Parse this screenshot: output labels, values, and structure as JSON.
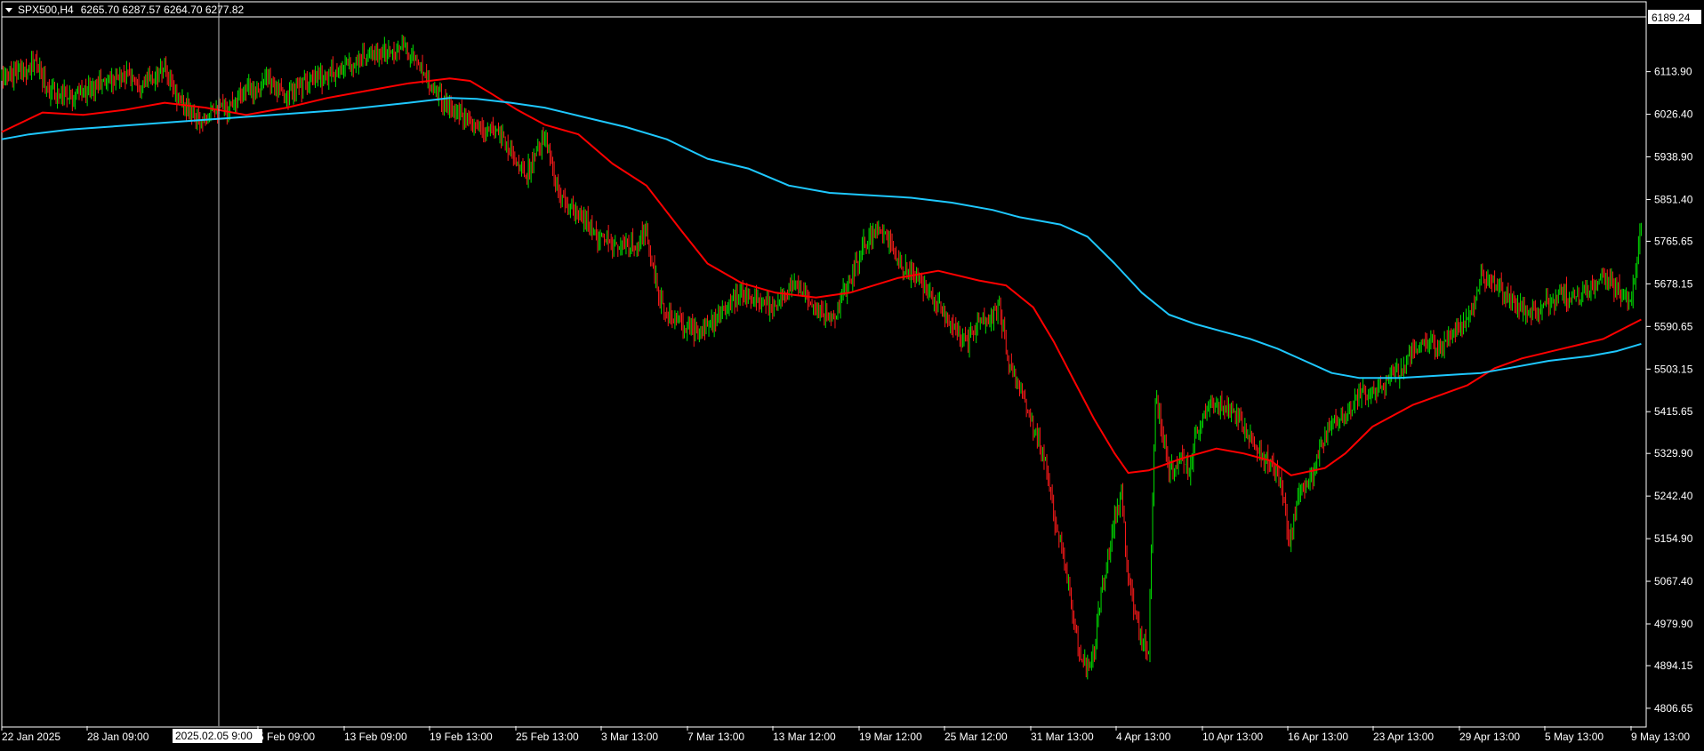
{
  "header": {
    "symbol": "SPX500,H4",
    "ohlc": "6265.70 6287.57 6264.70 6277.82"
  },
  "crosshair": {
    "time_label": "2025.02.05 9:00"
  },
  "price_marker": {
    "value_label": "6189.24"
  },
  "colors": {
    "background": "#000000",
    "frame": "#ffffff",
    "bull_candle": "#00e000",
    "bear_candle": "#ff1a1a",
    "ma_fast": "#ff0000",
    "ma_slow": "#1ec8ff",
    "text": "#ffffff"
  },
  "chart_data": {
    "type": "line",
    "title": "SPX500,H4",
    "ylim": [
      4770,
      6230
    ],
    "y_ticks": [
      "6113.90",
      "6026.40",
      "5938.90",
      "5851.40",
      "5765.65",
      "5678.15",
      "5590.65",
      "5503.15",
      "5415.65",
      "5329.90",
      "5242.40",
      "5154.90",
      "5067.40",
      "4979.90",
      "4894.15",
      "4806.65"
    ],
    "x_tick_labels": [
      "22 Jan 2025",
      "28 Jan 09:00",
      "5 Feb 09:00",
      "13 Feb 09:00",
      "19 Feb 13:00",
      "25 Feb 13:00",
      "3 Mar 13:00",
      "7 Mar 13:00",
      "13 Mar 12:00",
      "19 Mar 12:00",
      "25 Mar 12:00",
      "31 Mar 13:00",
      "4 Apr 13:00",
      "10 Apr 13:00",
      "16 Apr 13:00",
      "23 Apr 13:00",
      "29 Apr 13:00",
      "5 May 13:00",
      "9 May 13:00"
    ],
    "price_path": [
      [
        0,
        6100
      ],
      [
        25,
        6130
      ],
      [
        35,
        6075
      ],
      [
        55,
        6065
      ],
      [
        70,
        6085
      ],
      [
        90,
        6110
      ],
      [
        105,
        6090
      ],
      [
        120,
        6115
      ],
      [
        130,
        6060
      ],
      [
        145,
        6010
      ],
      [
        155,
        6045
      ],
      [
        165,
        6035
      ],
      [
        175,
        6070
      ],
      [
        185,
        6080
      ],
      [
        195,
        6095
      ],
      [
        210,
        6060
      ],
      [
        220,
        6085
      ],
      [
        235,
        6100
      ],
      [
        250,
        6120
      ],
      [
        265,
        6140
      ],
      [
        275,
        6150
      ],
      [
        285,
        6155
      ],
      [
        295,
        6165
      ],
      [
        305,
        6140
      ],
      [
        315,
        6095
      ],
      [
        325,
        6055
      ],
      [
        335,
        6030
      ],
      [
        345,
        6005
      ],
      [
        355,
        5990
      ],
      [
        365,
        6000
      ],
      [
        375,
        5950
      ],
      [
        385,
        5900
      ],
      [
        393,
        5935
      ],
      [
        400,
        5985
      ],
      [
        410,
        5860
      ],
      [
        420,
        5825
      ],
      [
        430,
        5810
      ],
      [
        440,
        5770
      ],
      [
        452,
        5760
      ],
      [
        462,
        5755
      ],
      [
        475,
        5780
      ],
      [
        485,
        5640
      ],
      [
        495,
        5605
      ],
      [
        505,
        5590
      ],
      [
        515,
        5580
      ],
      [
        525,
        5600
      ],
      [
        535,
        5630
      ],
      [
        545,
        5660
      ],
      [
        555,
        5655
      ],
      [
        565,
        5630
      ],
      [
        575,
        5650
      ],
      [
        585,
        5680
      ],
      [
        595,
        5650
      ],
      [
        605,
        5610
      ],
      [
        615,
        5625
      ],
      [
        625,
        5685
      ],
      [
        635,
        5760
      ],
      [
        645,
        5790
      ],
      [
        655,
        5760
      ],
      [
        665,
        5710
      ],
      [
        675,
        5690
      ],
      [
        685,
        5660
      ],
      [
        695,
        5615
      ],
      [
        705,
        5575
      ],
      [
        712,
        5560
      ],
      [
        720,
        5595
      ],
      [
        728,
        5600
      ],
      [
        735,
        5635
      ],
      [
        742,
        5515
      ],
      [
        752,
        5450
      ],
      [
        762,
        5370
      ],
      [
        770,
        5300
      ],
      [
        775,
        5200
      ],
      [
        780,
        5150
      ],
      [
        785,
        5080
      ],
      [
        790,
        4990
      ],
      [
        795,
        4900
      ],
      [
        800,
        4890
      ],
      [
        805,
        4920
      ],
      [
        810,
        5050
      ],
      [
        815,
        5110
      ],
      [
        820,
        5200
      ],
      [
        825,
        5240
      ],
      [
        830,
        5080
      ],
      [
        835,
        5000
      ],
      [
        840,
        4950
      ],
      [
        845,
        4920
      ],
      [
        850,
        5450
      ],
      [
        855,
        5380
      ],
      [
        860,
        5300
      ],
      [
        870,
        5320
      ],
      [
        875,
        5290
      ],
      [
        880,
        5380
      ],
      [
        890,
        5420
      ],
      [
        900,
        5430
      ],
      [
        910,
        5400
      ],
      [
        920,
        5360
      ],
      [
        930,
        5320
      ],
      [
        938,
        5295
      ],
      [
        943,
        5260
      ],
      [
        948,
        5150
      ],
      [
        953,
        5210
      ],
      [
        958,
        5260
      ],
      [
        965,
        5280
      ],
      [
        972,
        5345
      ],
      [
        980,
        5400
      ],
      [
        990,
        5395
      ],
      [
        1000,
        5460
      ],
      [
        1010,
        5450
      ],
      [
        1020,
        5480
      ],
      [
        1030,
        5500
      ],
      [
        1040,
        5540
      ],
      [
        1050,
        5560
      ],
      [
        1060,
        5550
      ],
      [
        1070,
        5575
      ],
      [
        1080,
        5600
      ],
      [
        1085,
        5640
      ],
      [
        1090,
        5695
      ],
      [
        1100,
        5680
      ],
      [
        1110,
        5650
      ],
      [
        1120,
        5625
      ],
      [
        1130,
        5615
      ],
      [
        1140,
        5640
      ],
      [
        1150,
        5660
      ],
      [
        1160,
        5645
      ],
      [
        1170,
        5665
      ],
      [
        1180,
        5690
      ],
      [
        1190,
        5670
      ],
      [
        1200,
        5640
      ],
      [
        1205,
        5735
      ],
      [
        1208,
        5805
      ]
    ],
    "series": [
      {
        "values": [
          [
            0,
            5990
          ],
          [
            30,
            6030
          ],
          [
            60,
            6025
          ],
          [
            90,
            6035
          ],
          [
            120,
            6050
          ],
          [
            150,
            6040
          ],
          [
            180,
            6025
          ],
          [
            210,
            6040
          ],
          [
            240,
            6060
          ],
          [
            270,
            6075
          ],
          [
            300,
            6090
          ],
          [
            330,
            6100
          ],
          [
            345,
            6095
          ],
          [
            360,
            6070
          ],
          [
            380,
            6035
          ],
          [
            400,
            6005
          ],
          [
            425,
            5985
          ],
          [
            450,
            5925
          ],
          [
            475,
            5880
          ],
          [
            500,
            5790
          ],
          [
            520,
            5720
          ],
          [
            545,
            5680
          ],
          [
            570,
            5660
          ],
          [
            600,
            5650
          ],
          [
            625,
            5660
          ],
          [
            660,
            5690
          ],
          [
            690,
            5705
          ],
          [
            720,
            5685
          ],
          [
            740,
            5675
          ],
          [
            760,
            5630
          ],
          [
            775,
            5560
          ],
          [
            790,
            5480
          ],
          [
            805,
            5400
          ],
          [
            820,
            5330
          ],
          [
            830,
            5290
          ],
          [
            845,
            5295
          ],
          [
            870,
            5320
          ],
          [
            895,
            5340
          ],
          [
            915,
            5330
          ],
          [
            935,
            5315
          ],
          [
            950,
            5285
          ],
          [
            975,
            5300
          ],
          [
            990,
            5330
          ],
          [
            1010,
            5385
          ],
          [
            1040,
            5430
          ],
          [
            1060,
            5450
          ],
          [
            1080,
            5470
          ],
          [
            1100,
            5505
          ],
          [
            1120,
            5525
          ],
          [
            1150,
            5545
          ],
          [
            1180,
            5565
          ],
          [
            1208,
            5605
          ]
        ]
      },
      {
        "values": [
          [
            0,
            5975
          ],
          [
            20,
            5985
          ],
          [
            50,
            5995
          ],
          [
            100,
            6005
          ],
          [
            150,
            6015
          ],
          [
            200,
            6025
          ],
          [
            250,
            6035
          ],
          [
            300,
            6050
          ],
          [
            330,
            6060
          ],
          [
            350,
            6058
          ],
          [
            375,
            6050
          ],
          [
            400,
            6040
          ],
          [
            430,
            6020
          ],
          [
            460,
            6000
          ],
          [
            490,
            5975
          ],
          [
            520,
            5935
          ],
          [
            550,
            5915
          ],
          [
            580,
            5880
          ],
          [
            610,
            5865
          ],
          [
            640,
            5860
          ],
          [
            670,
            5855
          ],
          [
            700,
            5845
          ],
          [
            730,
            5830
          ],
          [
            750,
            5815
          ],
          [
            780,
            5800
          ],
          [
            800,
            5775
          ],
          [
            820,
            5720
          ],
          [
            840,
            5660
          ],
          [
            860,
            5615
          ],
          [
            880,
            5595
          ],
          [
            900,
            5580
          ],
          [
            920,
            5565
          ],
          [
            940,
            5545
          ],
          [
            960,
            5520
          ],
          [
            980,
            5495
          ],
          [
            1000,
            5485
          ],
          [
            1030,
            5485
          ],
          [
            1060,
            5490
          ],
          [
            1090,
            5495
          ],
          [
            1110,
            5505
          ],
          [
            1140,
            5520
          ],
          [
            1170,
            5530
          ],
          [
            1190,
            5540
          ],
          [
            1208,
            5555
          ]
        ]
      }
    ]
  }
}
